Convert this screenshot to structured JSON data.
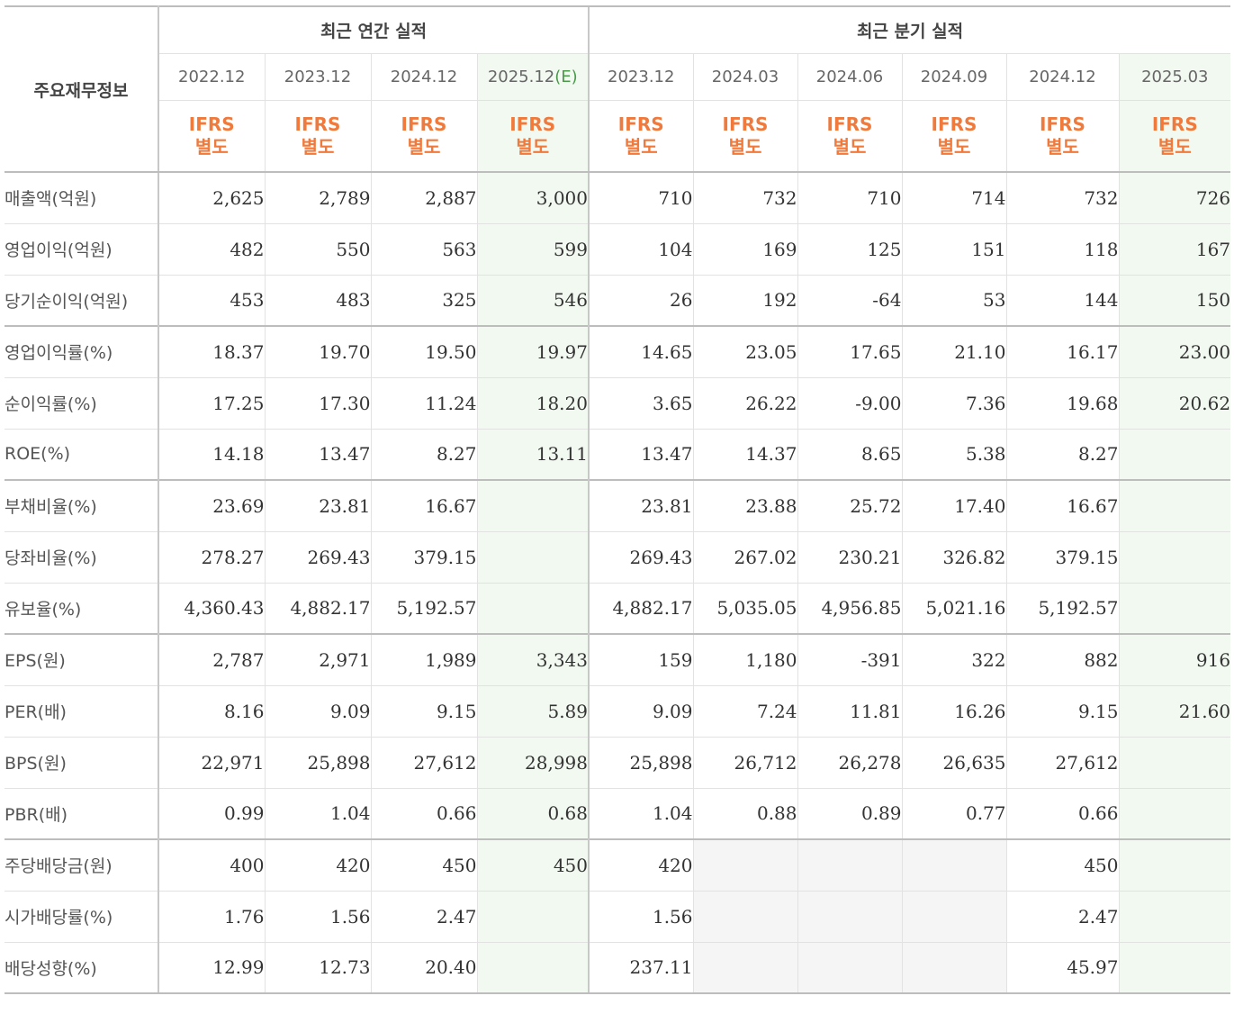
{
  "header": {
    "corner_label": "주요재무정보",
    "annual_group": "최근 연간 실적",
    "quarterly_group": "최근 분기 실적",
    "annual_dates": [
      "2022.12",
      "2023.12",
      "2024.12",
      "2025.12"
    ],
    "quarterly_dates": [
      "2023.12",
      "2024.03",
      "2024.06",
      "2024.09",
      "2024.12",
      "2025.03"
    ],
    "estimate_mark": "(E)",
    "ifrs_line1": "IFRS",
    "ifrs_line2": "별도"
  },
  "rows": [
    {
      "label": "매출액(억원)",
      "annual": [
        "2,625",
        "2,789",
        "2,887",
        "3,000"
      ],
      "quarterly": [
        "710",
        "732",
        "710",
        "714",
        "732",
        "726"
      ]
    },
    {
      "label": "영업이익(억원)",
      "annual": [
        "482",
        "550",
        "563",
        "599"
      ],
      "quarterly": [
        "104",
        "169",
        "125",
        "151",
        "118",
        "167"
      ]
    },
    {
      "label": "당기순이익(억원)",
      "annual": [
        "453",
        "483",
        "325",
        "546"
      ],
      "quarterly": [
        "26",
        "192",
        "-64",
        "53",
        "144",
        "150"
      ]
    },
    {
      "label": "영업이익률(%)",
      "annual": [
        "18.37",
        "19.70",
        "19.50",
        "19.97"
      ],
      "quarterly": [
        "14.65",
        "23.05",
        "17.65",
        "21.10",
        "16.17",
        "23.00"
      ]
    },
    {
      "label": "순이익률(%)",
      "annual": [
        "17.25",
        "17.30",
        "11.24",
        "18.20"
      ],
      "quarterly": [
        "3.65",
        "26.22",
        "-9.00",
        "7.36",
        "19.68",
        "20.62"
      ]
    },
    {
      "label": "ROE(%)",
      "annual": [
        "14.18",
        "13.47",
        "8.27",
        "13.11"
      ],
      "quarterly": [
        "13.47",
        "14.37",
        "8.65",
        "5.38",
        "8.27",
        ""
      ]
    },
    {
      "label": "부채비율(%)",
      "annual": [
        "23.69",
        "23.81",
        "16.67",
        ""
      ],
      "quarterly": [
        "23.81",
        "23.88",
        "25.72",
        "17.40",
        "16.67",
        ""
      ]
    },
    {
      "label": "당좌비율(%)",
      "annual": [
        "278.27",
        "269.43",
        "379.15",
        ""
      ],
      "quarterly": [
        "269.43",
        "267.02",
        "230.21",
        "326.82",
        "379.15",
        ""
      ]
    },
    {
      "label": "유보율(%)",
      "annual": [
        "4,360.43",
        "4,882.17",
        "5,192.57",
        ""
      ],
      "quarterly": [
        "4,882.17",
        "5,035.05",
        "4,956.85",
        "5,021.16",
        "5,192.57",
        ""
      ]
    },
    {
      "label": "EPS(원)",
      "annual": [
        "2,787",
        "2,971",
        "1,989",
        "3,343"
      ],
      "quarterly": [
        "159",
        "1,180",
        "-391",
        "322",
        "882",
        "916"
      ]
    },
    {
      "label": "PER(배)",
      "annual": [
        "8.16",
        "9.09",
        "9.15",
        "5.89"
      ],
      "quarterly": [
        "9.09",
        "7.24",
        "11.81",
        "16.26",
        "9.15",
        "21.60"
      ]
    },
    {
      "label": "BPS(원)",
      "annual": [
        "22,971",
        "25,898",
        "27,612",
        "28,998"
      ],
      "quarterly": [
        "25,898",
        "26,712",
        "26,278",
        "26,635",
        "27,612",
        ""
      ]
    },
    {
      "label": "PBR(배)",
      "annual": [
        "0.99",
        "1.04",
        "0.66",
        "0.68"
      ],
      "quarterly": [
        "1.04",
        "0.88",
        "0.89",
        "0.77",
        "0.66",
        ""
      ]
    },
    {
      "label": "주당배당금(원)",
      "annual": [
        "400",
        "420",
        "450",
        "450"
      ],
      "quarterly": [
        "420",
        "",
        "",
        "",
        "450",
        ""
      ]
    },
    {
      "label": "시가배당률(%)",
      "annual": [
        "1.76",
        "1.56",
        "2.47",
        ""
      ],
      "quarterly": [
        "1.56",
        "",
        "",
        "",
        "2.47",
        ""
      ]
    },
    {
      "label": "배당성향(%)",
      "annual": [
        "12.99",
        "12.73",
        "20.40",
        ""
      ],
      "quarterly": [
        "237.11",
        "",
        "",
        "",
        "45.97",
        ""
      ]
    }
  ],
  "colors": {
    "ifrs_orange": "#f07a3c",
    "estimate_green": "#4a9a4a",
    "negative_red": "#e0201f",
    "forecast_bg": "#f2f9f1",
    "empty_bg": "#f5f5f5"
  }
}
